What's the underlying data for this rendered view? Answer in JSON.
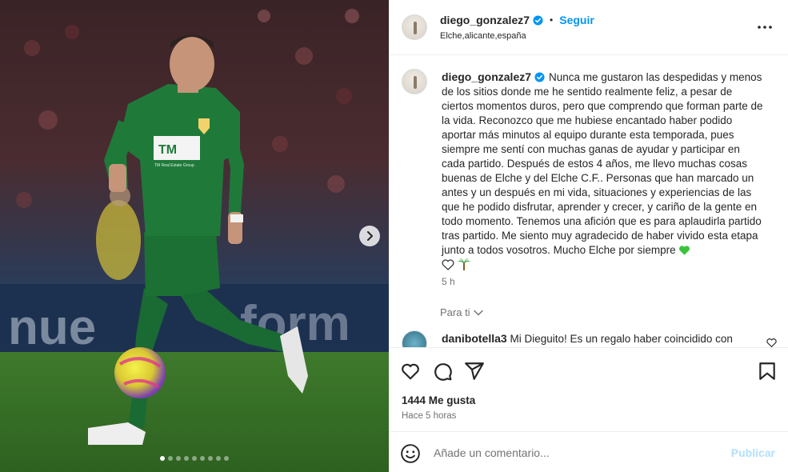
{
  "media": {
    "jersey_text_1": "TM",
    "jersey_text_2": "TM Real Estate Group",
    "board_text": "nue",
    "board_text_2": "form",
    "slide_count": 9,
    "active_slide": 1,
    "next_icon": "chevron-right-icon"
  },
  "header": {
    "username": "diego_gonzalez7",
    "separator": "•",
    "follow_label": "Seguir",
    "location": "Elche,alicante,españa",
    "more_icon": "more-horizontal-icon"
  },
  "caption": {
    "username": "diego_gonzalez7",
    "text": "Nunca me gustaron las despedidas y menos de los sitios donde me he sentido realmente feliz, a pesar de ciertos momentos duros, pero que comprendo que forman parte de la vida. Reconozco que me hubiese encantado haber podido aportar más minutos al equipo durante esta temporada, pues siempre me sentí con muchas ganas de ayudar y participar en cada partido. Después de estos 4 años, me llevo muchas cosas buenas de Elche y del Elche C.F.. Personas que han marcado un antes y un después en mi vida, situaciones y experiencias de las que he podido disfrutar, aprender y crecer, y cariño de la gente en todo momento. Tenemos una afición que es para aplaudirla partido tras partido. Me siento muy agradecido de haber vivido esta etapa junto a todos vosotros. Mucho Elche por siempre",
    "time": "5 h"
  },
  "for_you": {
    "label": "Para ti"
  },
  "comment": {
    "username": "danibotella3",
    "text": "Mi Dieguito! Es un regalo haber coincidido con"
  },
  "stats": {
    "likes": "1444 Me gusta",
    "time_ago": "Hace 5 horas"
  },
  "composer": {
    "placeholder": "Añade un comentario...",
    "publish_label": "Publicar"
  },
  "colors": {
    "accent": "#0095f6",
    "jersey": "#1f7a3a",
    "muted": "#737373"
  }
}
